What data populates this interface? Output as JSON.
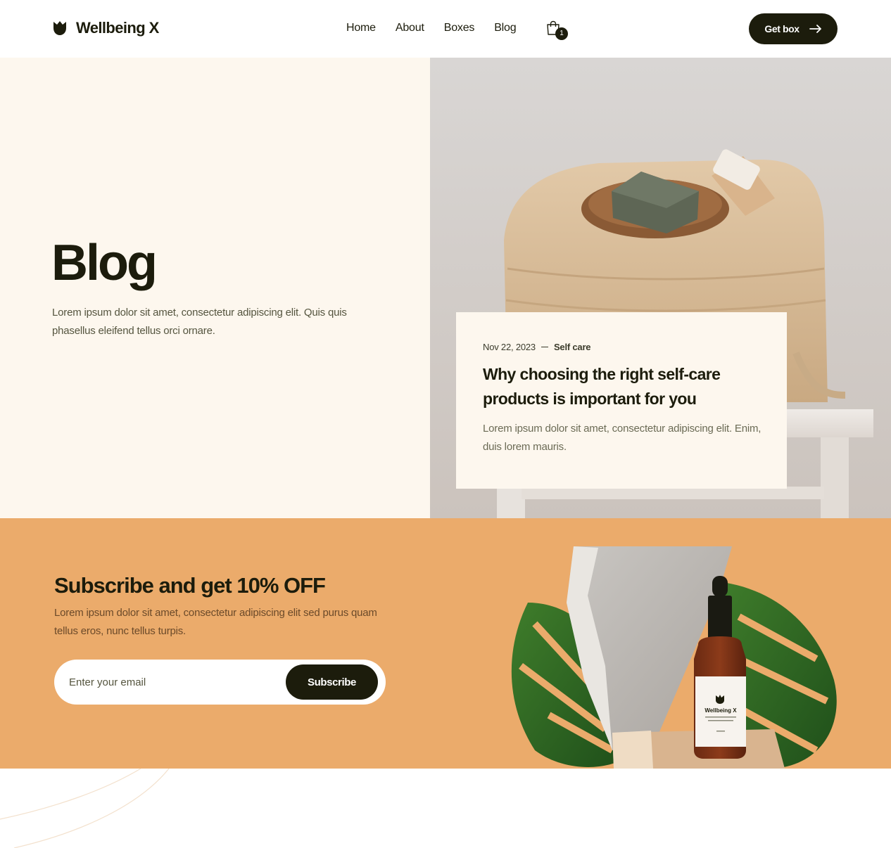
{
  "brand": {
    "name": "Wellbeing X"
  },
  "nav": {
    "items": [
      {
        "label": "Home"
      },
      {
        "label": "About"
      },
      {
        "label": "Boxes"
      },
      {
        "label": "Blog"
      }
    ],
    "cart_count": "1",
    "cta_label": "Get box"
  },
  "hero": {
    "title": "Blog",
    "description": "Lorem ipsum dolor sit amet, consectetur adipiscing elit. Quis quis phasellus eleifend tellus orci ornare."
  },
  "featured_post": {
    "date": "Nov 22, 2023",
    "category": "Self care",
    "title": "Why choosing the right self-care products is important for you",
    "excerpt": "Lorem ipsum dolor sit amet, consectetur adipiscing elit. Enim, duis lorem mauris."
  },
  "subscribe": {
    "title": "Subscribe and get 10% OFF",
    "description": "Lorem ipsum dolor sit amet, consectetur adipiscing elit sed purus quam tellus eros, nunc tellus turpis.",
    "email_placeholder": "Enter your email",
    "button_label": "Subscribe",
    "product_label": "Wellbeing X"
  },
  "colors": {
    "dark": "#1c1c0c",
    "cream": "#fdf7ee",
    "orange": "#ebab6b"
  },
  "icons": {
    "logo": "tulip-logo-icon",
    "cart": "shopping-bag-icon",
    "arrow": "arrow-right-icon"
  }
}
